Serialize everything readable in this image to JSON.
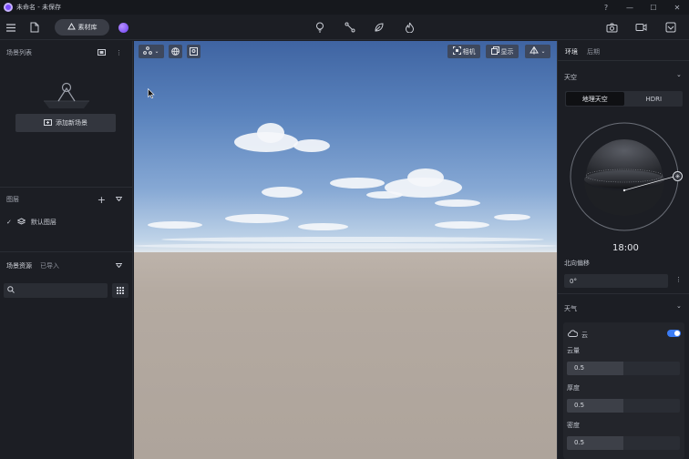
{
  "titlebar": {
    "title": "未命名 - 未保存"
  },
  "toolbar": {
    "library_label": "素材库"
  },
  "left": {
    "scene_list_title": "场景列表",
    "add_scene_label": "添加新场景",
    "layers_title": "图层",
    "default_layer": "默认图层",
    "assets_tab": "场景资源",
    "imported_tab": "已导入"
  },
  "viewport": {
    "camera_label": "相机",
    "display_label": "显示"
  },
  "right": {
    "tab_env": "环境",
    "tab_light": "后期",
    "sky_section": "天空",
    "seg_geo": "地理天空",
    "seg_hdri": "HDRI",
    "time": "18:00",
    "north_label": "北向偏移",
    "north_value": "0°",
    "weather_section": "天气",
    "cloud_label": "云",
    "cloud_amount_label": "云量",
    "cloud_amount_value": "0.5",
    "cloud_amount": 0.5,
    "thickness_label": "厚度",
    "thickness_value": "0.5",
    "thickness": 0.5,
    "density_label": "密度",
    "density_value": "0.5",
    "density": 0.5
  },
  "colors": {
    "accent": "#3b7cf5",
    "brand": "#7b4dff"
  }
}
